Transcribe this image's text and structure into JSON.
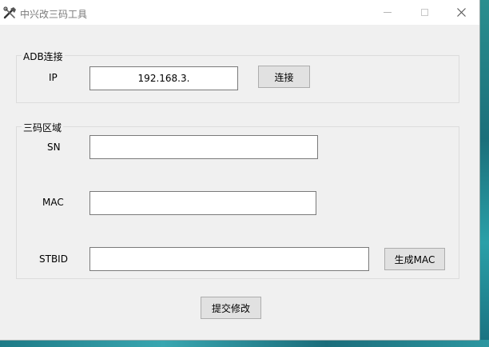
{
  "window": {
    "title": "中兴改三码工具",
    "minimize_icon": "minimize-icon",
    "maximize_icon": "maximize-icon",
    "close_icon": "close-icon"
  },
  "adb_group": {
    "legend": "ADB连接",
    "ip_label": "IP",
    "ip_value": "192.168.3.",
    "connect_button": "连接"
  },
  "codes_group": {
    "legend": "三码区域",
    "sn_label": "SN",
    "sn_value": "",
    "mac_label": "MAC",
    "mac_value": "",
    "stbid_label": "STBID",
    "stbid_value": "",
    "generate_mac_button": "生成MAC"
  },
  "submit_button": "提交修改"
}
